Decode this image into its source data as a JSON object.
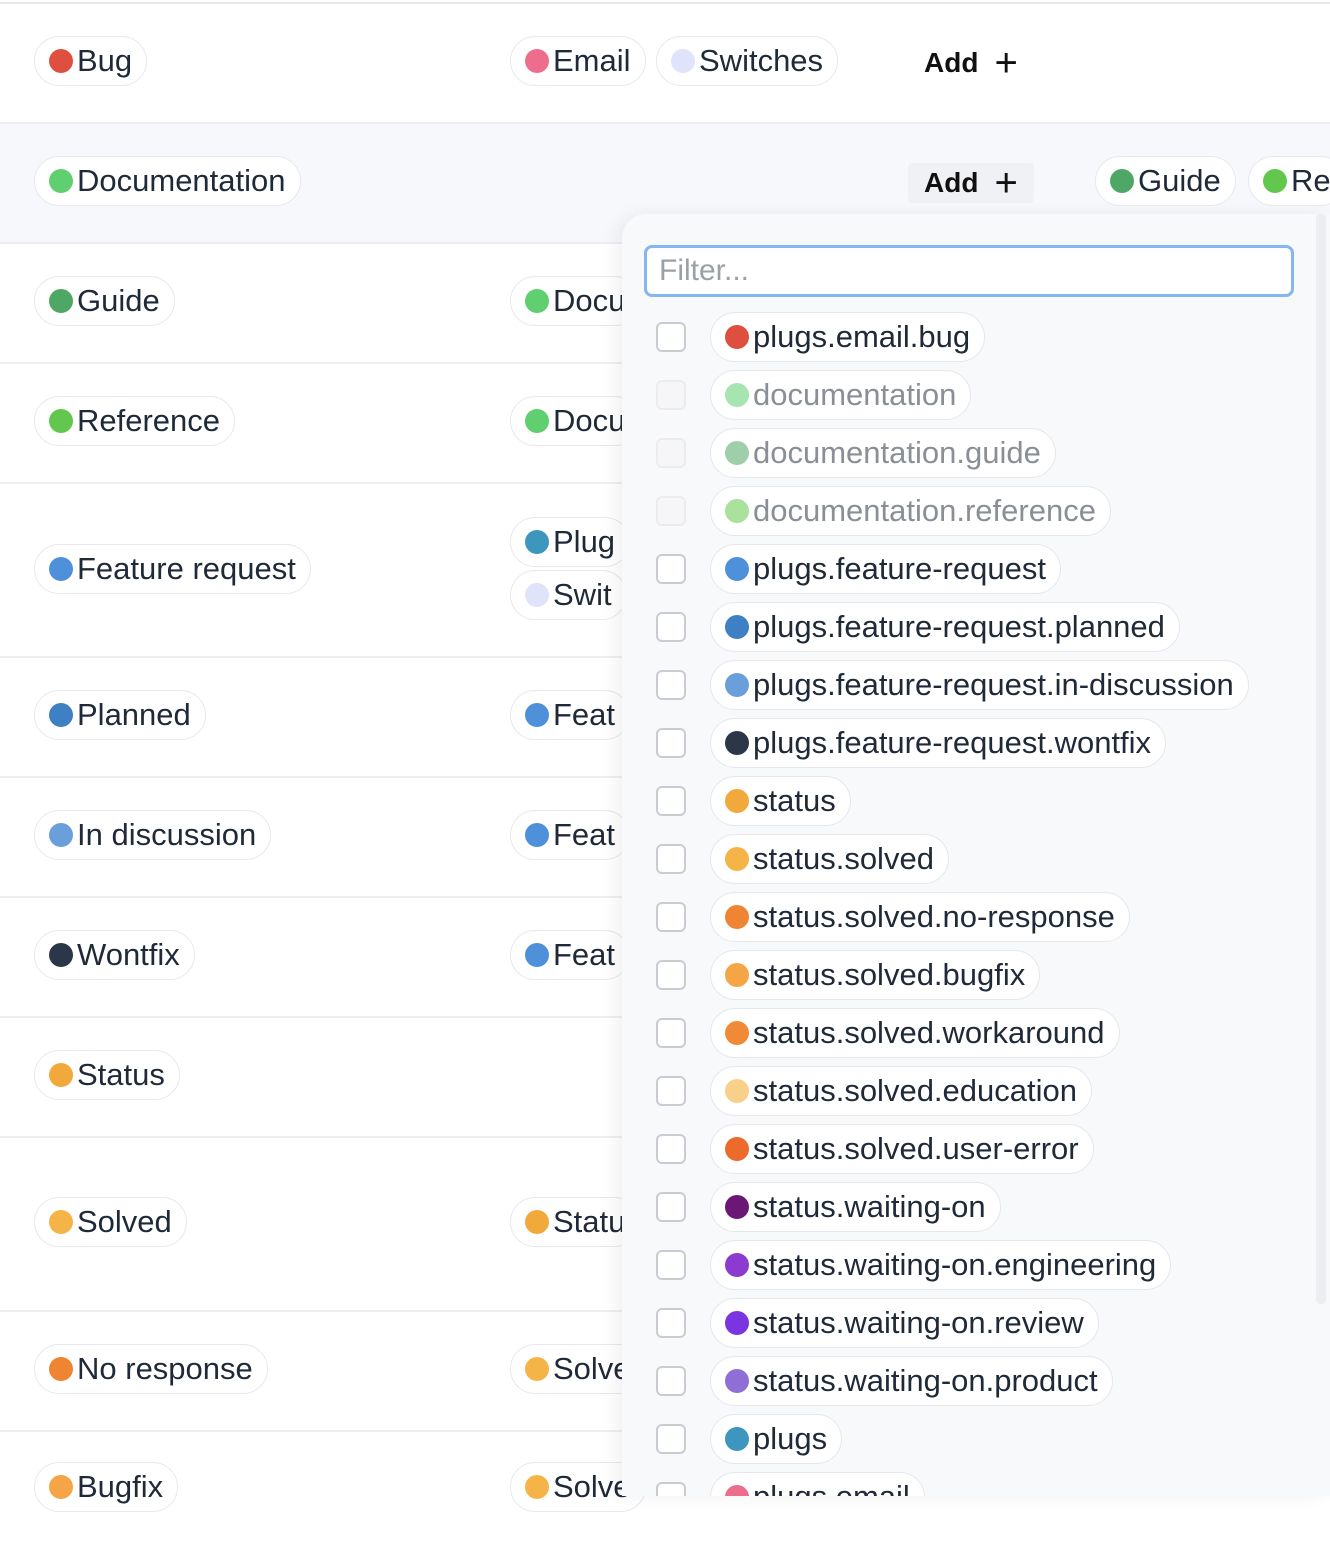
{
  "rows": [
    {
      "label": "Bug",
      "color": "#df4f3f",
      "parents": [
        {
          "label": "Email",
          "color": "#ec6e8c"
        },
        {
          "label": "Switches",
          "color": "#dfe4fb"
        }
      ],
      "add_label": "Add",
      "add_icon": "plus-icon"
    },
    {
      "label": "Documentation",
      "color": "#5fcf6f",
      "add_label": "Add",
      "add_icon": "plus-icon",
      "children": [
        {
          "label": "Guide",
          "color": "#4fa765"
        },
        {
          "label": "Re",
          "color": "#62c84d"
        }
      ]
    },
    {
      "label": "Guide",
      "color": "#4fa765",
      "parents": [
        {
          "label": "Docu",
          "color": "#5fcf6f"
        }
      ]
    },
    {
      "label": "Reference",
      "color": "#62c84d",
      "parents": [
        {
          "label": "Docu",
          "color": "#5fcf6f"
        }
      ]
    },
    {
      "label": "Feature request",
      "color": "#4f90db",
      "parents": [
        {
          "label": "Plug",
          "color": "#3d96bd"
        },
        {
          "label": "Swit",
          "color": "#dfe4fb"
        }
      ]
    },
    {
      "label": "Planned",
      "color": "#3f7fc3",
      "parents": [
        {
          "label": "Feat",
          "color": "#4f90db"
        }
      ]
    },
    {
      "label": "In discussion",
      "color": "#6a9fdb",
      "parents": [
        {
          "label": "Feat",
          "color": "#4f90db"
        }
      ]
    },
    {
      "label": "Wontfix",
      "color": "#2b3648",
      "parents": [
        {
          "label": "Feat",
          "color": "#4f90db"
        }
      ]
    },
    {
      "label": "Status",
      "color": "#f2a93b",
      "parents": []
    },
    {
      "label": "Solved",
      "color": "#f5b447",
      "parents": [
        {
          "label": "Statu",
          "color": "#f2a93b"
        }
      ]
    },
    {
      "label": "No response",
      "color": "#ef8433",
      "parents": [
        {
          "label": "Solve",
          "color": "#f5b447"
        }
      ]
    },
    {
      "label": "Bugfix",
      "color": "#f5a545",
      "parents": [
        {
          "label": "Solve",
          "color": "#f5b447"
        }
      ]
    }
  ],
  "dropdown": {
    "filter_placeholder": "Filter...",
    "options": [
      {
        "label": "plugs.email.bug",
        "color": "#df4f3f",
        "disabled": false
      },
      {
        "label": "documentation",
        "color": "#5fcf6f",
        "disabled": true
      },
      {
        "label": "documentation.guide",
        "color": "#4fa765",
        "disabled": true
      },
      {
        "label": "documentation.reference",
        "color": "#62c84d",
        "disabled": true
      },
      {
        "label": "plugs.feature-request",
        "color": "#4f90db",
        "disabled": false
      },
      {
        "label": "plugs.feature-request.planned",
        "color": "#3f7fc3",
        "disabled": false
      },
      {
        "label": "plugs.feature-request.in-discussion",
        "color": "#6a9fdb",
        "disabled": false
      },
      {
        "label": "plugs.feature-request.wontfix",
        "color": "#2b3648",
        "disabled": false
      },
      {
        "label": "status",
        "color": "#f2a93b",
        "disabled": false
      },
      {
        "label": "status.solved",
        "color": "#f5b447",
        "disabled": false
      },
      {
        "label": "status.solved.no-response",
        "color": "#ef8433",
        "disabled": false
      },
      {
        "label": "status.solved.bugfix",
        "color": "#f5a545",
        "disabled": false
      },
      {
        "label": "status.solved.workaround",
        "color": "#f08a36",
        "disabled": false
      },
      {
        "label": "status.solved.education",
        "color": "#f8d08a",
        "disabled": false
      },
      {
        "label": "status.solved.user-error",
        "color": "#ec6a2c",
        "disabled": false
      },
      {
        "label": "status.waiting-on",
        "color": "#6b1776",
        "disabled": false
      },
      {
        "label": "status.waiting-on.engineering",
        "color": "#8c3bd0",
        "disabled": false
      },
      {
        "label": "status.waiting-on.review",
        "color": "#7a35e0",
        "disabled": false
      },
      {
        "label": "status.waiting-on.product",
        "color": "#8f6fd6",
        "disabled": false
      },
      {
        "label": "plugs",
        "color": "#3d96bd",
        "disabled": false
      },
      {
        "label": "plugs.email",
        "color": "#ec6e8c",
        "disabled": false
      }
    ]
  }
}
